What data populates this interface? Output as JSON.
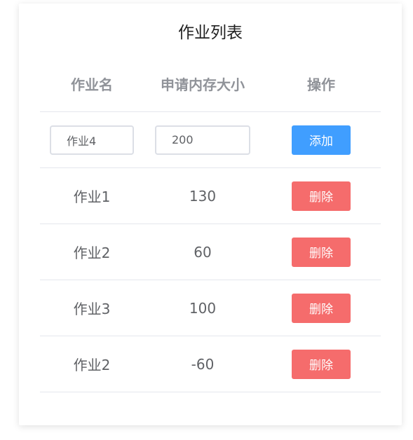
{
  "page": {
    "title": "作业列表"
  },
  "table": {
    "headers": [
      "作业名",
      "申请内存大小",
      "操作"
    ],
    "input_row": {
      "name_value": "作业4",
      "size_value": "200",
      "add_label": "添加"
    },
    "rows": [
      {
        "name": "作业1",
        "size": "130",
        "action": "删除"
      },
      {
        "name": "作业2",
        "size": "60",
        "action": "删除"
      },
      {
        "name": "作业3",
        "size": "100",
        "action": "删除"
      },
      {
        "name": "作业2",
        "size": "-60",
        "action": "删除"
      }
    ]
  },
  "colors": {
    "primary": "#409eff",
    "danger": "#f56c6c",
    "header_text": "#909399",
    "body_text": "#606266",
    "divider": "#e4e7ed"
  }
}
